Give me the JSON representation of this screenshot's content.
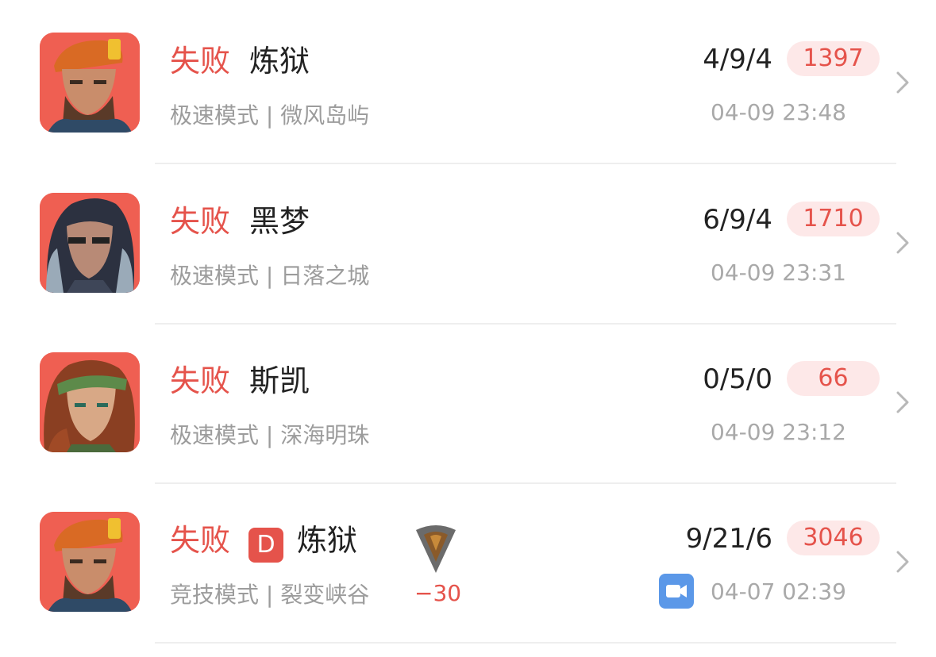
{
  "matches": [
    {
      "result": "失败",
      "hero": "炼狱",
      "mode_map": "极速模式 | 微风岛屿",
      "kda": "4/9/4",
      "score": "1397",
      "time": "04-09 23:48",
      "avatar": "beret-hero-avatar"
    },
    {
      "result": "失败",
      "hero": "黑梦",
      "mode_map": "极速模式 | 日落之城",
      "kda": "6/9/4",
      "score": "1710",
      "time": "04-09 23:31",
      "avatar": "dark-hair-hero-avatar"
    },
    {
      "result": "失败",
      "hero": "斯凯",
      "mode_map": "极速模式 | 深海明珠",
      "kda": "0/5/0",
      "score": "66",
      "time": "04-09 23:12",
      "avatar": "headband-hero-avatar"
    },
    {
      "result": "失败",
      "tier_badge": "D",
      "hero": "炼狱",
      "mode_map": "竞技模式 | 裂变峡谷",
      "rank_change": "−30",
      "kda": "9/21/6",
      "score": "3046",
      "time": "04-07 02:39",
      "avatar": "beret-hero-avatar",
      "icons": {
        "rank": "rank-tier-icon",
        "video": "video-replay-icon"
      }
    }
  ],
  "colors": {
    "loss": "#e5534b",
    "score_bg": "#fde8e8",
    "avatar_bg": "#ef5f52",
    "video": "#5b98e8"
  }
}
